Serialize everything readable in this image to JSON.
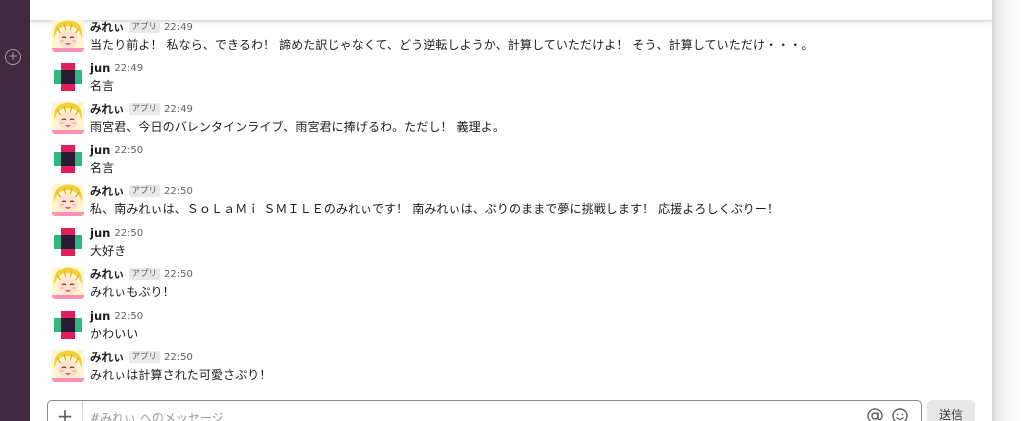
{
  "channel": {
    "placeholder": "#みれぃ へのメッセージ"
  },
  "buttons": {
    "send_label": "送信",
    "add_symbol": "+",
    "workspace_add_symbol": "+"
  },
  "messages": [
    {
      "user": "みれぃ",
      "badge": "アプリ",
      "time": "22:49",
      "text": "当たり前よ！ 私なら、できるわ！ 諦めた訳じゃなくて、どう逆転しようか、計算していただけよ！ そう、計算していただけ・・・。"
    },
    {
      "user": "jun",
      "time": "22:49",
      "text": "名言"
    },
    {
      "user": "みれぃ",
      "badge": "アプリ",
      "time": "22:49",
      "text": "雨宮君、今日のバレンタインライブ、雨宮君に捧げるわ。ただし！ 義理よ。"
    },
    {
      "user": "jun",
      "time": "22:50",
      "text": "名言"
    },
    {
      "user": "みれぃ",
      "badge": "アプリ",
      "time": "22:50",
      "text": "私、南みれぃは、ＳｏＬａＭｉ ＳＭＩＬＥのみれぃです！ 南みれぃは、ぷりのままで夢に挑戦します！ 応援よろしくぷりー！"
    },
    {
      "user": "jun",
      "time": "22:50",
      "text": "大好き"
    },
    {
      "user": "みれぃ",
      "badge": "アプリ",
      "time": "22:50",
      "text": "みれぃもぷり！"
    },
    {
      "user": "jun",
      "time": "22:50",
      "text": "かわいい"
    },
    {
      "user": "みれぃ",
      "badge": "アプリ",
      "time": "22:50",
      "text": "みれぃは計算された可愛さぷり！"
    }
  ],
  "colors": {
    "sidebar": "#3f2a3f",
    "jun_avatar_pink": "#e01e5a",
    "jun_avatar_green": "#2eb67d",
    "jun_avatar_dark": "#2a1a33"
  }
}
